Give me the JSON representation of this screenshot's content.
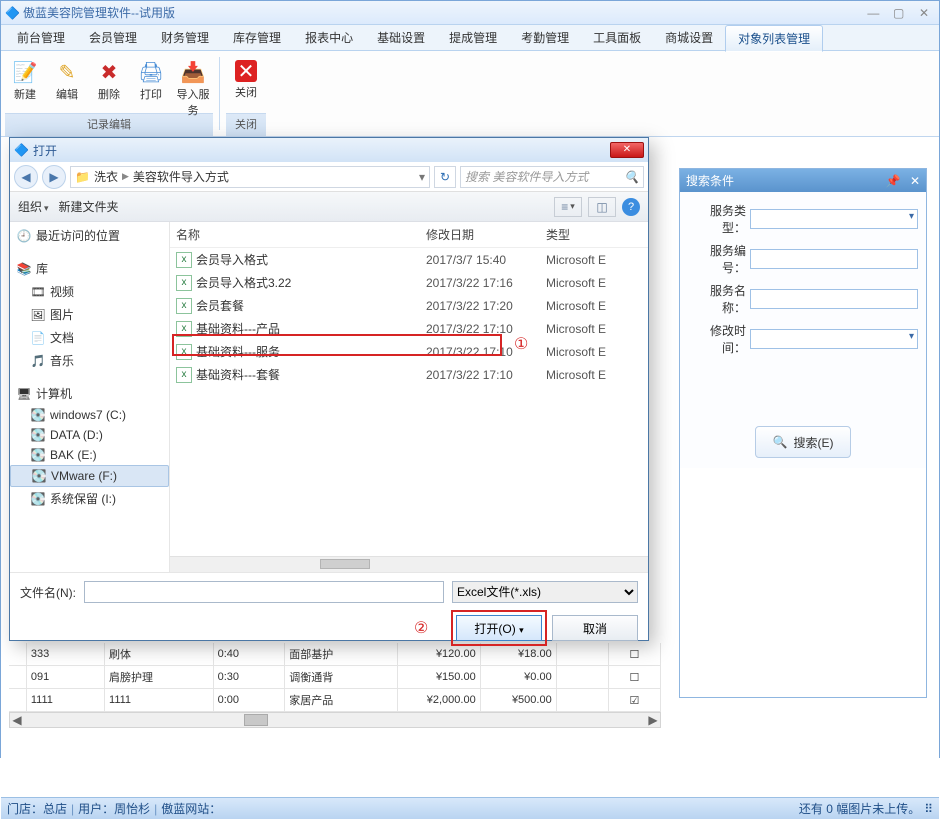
{
  "app": {
    "title": "傲蓝美容院管理软件--试用版"
  },
  "menubar": [
    "前台管理",
    "会员管理",
    "财务管理",
    "库存管理",
    "报表中心",
    "基础设置",
    "提成管理",
    "考勤管理",
    "工具面板",
    "商城设置",
    "对象列表管理"
  ],
  "menubar_active_index": 10,
  "toolbar": {
    "group_label": "记录编辑",
    "items": [
      {
        "name": "new",
        "label": "新建",
        "icon": "📝"
      },
      {
        "name": "edit",
        "label": "编辑",
        "icon": "✎"
      },
      {
        "name": "delete",
        "label": "删除",
        "icon": "✖"
      },
      {
        "name": "print",
        "label": "打印",
        "icon": "🖨"
      },
      {
        "name": "import",
        "label": "导入服务",
        "icon": "📥"
      }
    ],
    "close_label": "关闭",
    "close_group_label": "关闭"
  },
  "search_panel": {
    "title": "搜索条件",
    "fields": {
      "service_type": "服务类型：",
      "service_code": "服务编号：",
      "service_name": "服务名称：",
      "modified_time": "修改时间："
    },
    "button": "搜索(E)"
  },
  "table_rows": [
    {
      "code": "333",
      "name": "刷体",
      "dur": "0:40",
      "cat": "面部基护",
      "price": "¥120.00",
      "cost": "¥18.00",
      "chk": false
    },
    {
      "code": "091",
      "name": "肩膀护理",
      "dur": "0:30",
      "cat": "调衡通背",
      "price": "¥150.00",
      "cost": "¥0.00",
      "chk": false
    },
    {
      "code": "1111",
      "name": "1111",
      "dur": "0:00",
      "cat": "家居产品",
      "price": "¥2,000.00",
      "cost": "¥500.00",
      "chk": true
    }
  ],
  "statusbar": {
    "left_store": "门店：总店",
    "left_user": "用户：周怡杉",
    "left_site": "傲蓝网站：",
    "right": "还有 0 幅图片未上传。"
  },
  "file_dialog": {
    "title": "打开",
    "path_crumb1": "洗衣",
    "path_crumb2": "美容软件导入方式",
    "search_placeholder": "搜索 美容软件导入方式",
    "toolbar_organize": "组织",
    "toolbar_newfolder": "新建文件夹",
    "side": {
      "recent": "最近访问的位置",
      "lib": "库",
      "video": "视频",
      "picture": "图片",
      "doc": "文档",
      "music": "音乐",
      "computer": "计算机",
      "drv_c": "windows7 (C:)",
      "drv_d": "DATA (D:)",
      "drv_e": "BAK (E:)",
      "drv_f": "VMware (F:)",
      "drv_i": "系统保留 (I:)"
    },
    "columns": {
      "name": "名称",
      "date": "修改日期",
      "type": "类型"
    },
    "files": [
      {
        "name": "会员导入格式",
        "date": "2017/3/7 15:40",
        "type": "Microsoft E"
      },
      {
        "name": "会员导入格式3.22",
        "date": "2017/3/22 17:16",
        "type": "Microsoft E"
      },
      {
        "name": "会员套餐",
        "date": "2017/3/22 17:20",
        "type": "Microsoft E"
      },
      {
        "name": "基础资料---产品",
        "date": "2017/3/22 17:10",
        "type": "Microsoft E"
      },
      {
        "name": "基础资料---服务",
        "date": "2017/3/22 17:10",
        "type": "Microsoft E"
      },
      {
        "name": "基础资料---套餐",
        "date": "2017/3/22 17:10",
        "type": "Microsoft E"
      }
    ],
    "filename_label": "文件名(N):",
    "filetype_option": "Excel文件(*.xls)",
    "open_btn": "打开(O)",
    "cancel_btn": "取消",
    "annot1": "①",
    "annot2": "②"
  }
}
